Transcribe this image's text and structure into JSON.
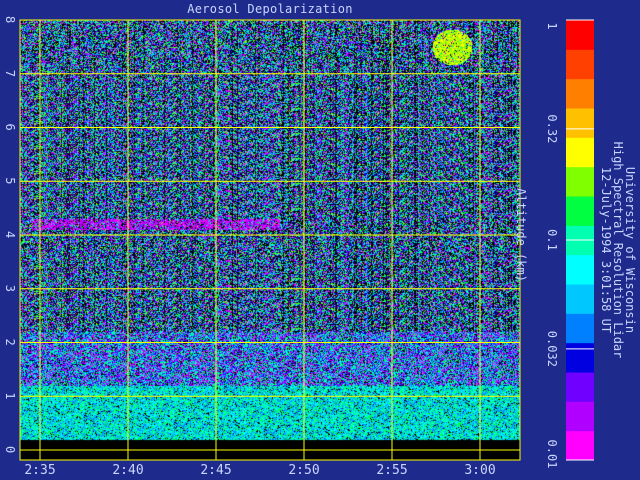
{
  "chart_data": {
    "type": "heatmap",
    "title": "Aerosol Depolarization",
    "ylabel": "Altitude (km)",
    "x_tick_labels": [
      "2:35",
      "2:40",
      "2:45",
      "2:50",
      "2:55",
      "3:00"
    ],
    "y_tick_labels": [
      "0",
      "1",
      "2",
      "3",
      "4",
      "5",
      "6",
      "7",
      "8"
    ],
    "ylim": [
      0,
      8
    ],
    "colorbar": {
      "scale": "log",
      "range": [
        0.01,
        1
      ],
      "tick_labels": [
        "1",
        "0.32",
        "0.1",
        "0.032",
        "0.01"
      ],
      "colors": [
        "#ff00ff",
        "#b000ff",
        "#7000ff",
        "#0000e0",
        "#0080ff",
        "#00c8ff",
        "#00ffff",
        "#00ffb0",
        "#00ff40",
        "#80ff00",
        "#ffff00",
        "#ffc000",
        "#ff8000",
        "#ff4000",
        "#ff0000"
      ]
    },
    "features": [
      {
        "description": "dense cyan/green depolarization near surface",
        "altitude_km": [
          0.2,
          1.2
        ]
      },
      {
        "description": "thin magenta aerosol layer",
        "altitude_km": [
          4.1,
          4.3
        ]
      },
      {
        "description": "high-depolarization cloud patch (yellow)",
        "time": "2:58",
        "altitude_km": [
          7.2,
          7.8
        ]
      }
    ],
    "grid": true
  },
  "side_text": {
    "line1": "University of Wisconsin",
    "line2": "High Spectral Resolution Lidar",
    "line3": "12-July-1994  3:01:58 UT"
  },
  "colors": {
    "background": "#1e2a8c",
    "grid": "#ffff00",
    "text": "#c9d6ff"
  }
}
